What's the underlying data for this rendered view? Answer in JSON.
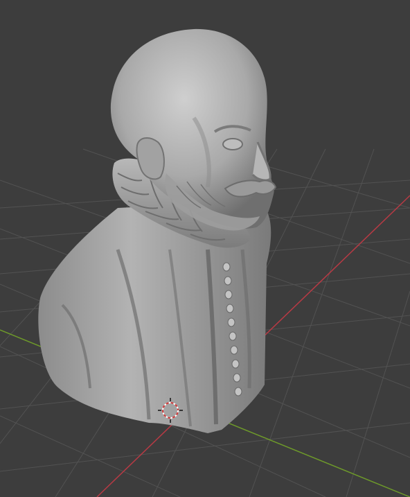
{
  "viewport": {
    "background": "#3d3d3d",
    "grid_color": "#555555",
    "x_axis_color": "#b83a44",
    "y_axis_color": "#6e9a2a",
    "model_color": "#a9a9a9",
    "model_shadow": "#6f6f6f",
    "model_highlight": "#cfcfcf"
  },
  "scene": {
    "object": "bust-sculpt",
    "origin_marker": "3d-cursor-icon"
  }
}
